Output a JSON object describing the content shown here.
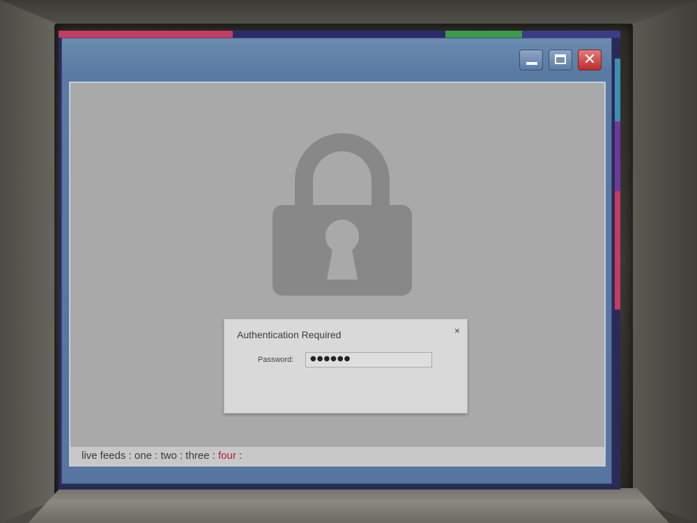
{
  "colors": {
    "accent_segments": [
      "#c43b63",
      "#2b2b6a",
      "#3a9a4a",
      "#3b3b86"
    ],
    "close_button": "#c42d2d",
    "window_frame": "#5a79a3",
    "client_bg": "#a9a9aa",
    "active_feed": "#b0213b"
  },
  "window": {
    "controls": {
      "minimize_icon": "minimize-icon",
      "maximize_icon": "maximize-icon",
      "close_icon": "close-icon",
      "close_glyph": "✕"
    },
    "background_icon": "padlock-icon"
  },
  "dialog": {
    "title": "Authentication Required",
    "close_glyph": "×",
    "password_label": "Password:",
    "password_value": "●●●●●●"
  },
  "feeds": {
    "prefix": "live feeds",
    "separator": " : ",
    "items": [
      {
        "label": "one",
        "active": false
      },
      {
        "label": "two",
        "active": false
      },
      {
        "label": "three",
        "active": false
      },
      {
        "label": "four",
        "active": true
      }
    ],
    "suffix": " :"
  }
}
